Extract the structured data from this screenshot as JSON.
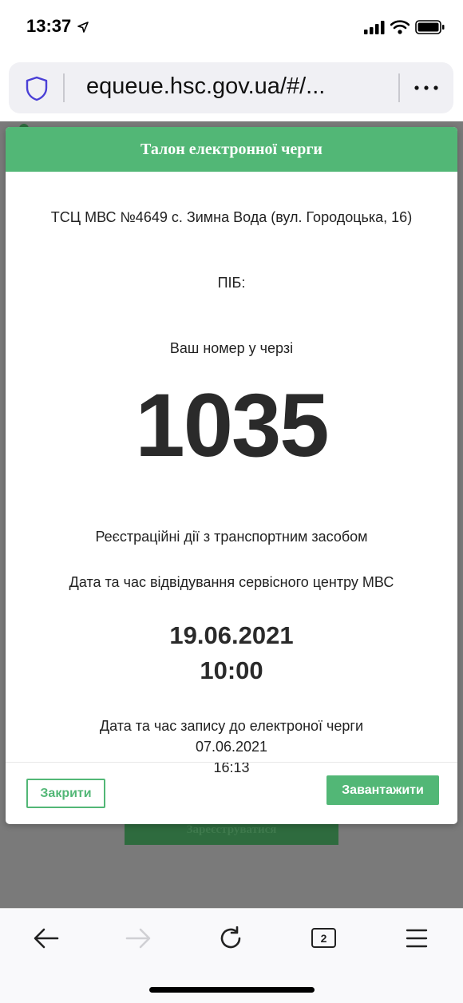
{
  "status_bar": {
    "time": "13:37"
  },
  "browser": {
    "url": "equeue.hsc.gov.ua/#/...",
    "tab_count": "2"
  },
  "background_page": {
    "register_label": "Зареєструватися"
  },
  "ticket": {
    "title": "Талон електронної черги",
    "service_center": "ТСЦ МВС №4649 с. Зимна Вода (вул. Городоцька, 16)",
    "pib_label": "ПІБ:",
    "queue_number_label": "Ваш номер у черзі",
    "queue_number": "1035",
    "service_name": "Реєстраційні дії з транспортним засобом",
    "visit_label": "Дата та час відвідування сервісного центру МВС",
    "visit_date": "19.06.2021",
    "visit_time": "10:00",
    "registration_label": "Дата та час запису до електроної черги",
    "registration_date": "07.06.2021",
    "registration_time": "16:13"
  },
  "buttons": {
    "close": "Закрити",
    "download": "Завантажити"
  },
  "colors": {
    "accent_green": "#52b776",
    "dim_overlay": "#7a7a7a",
    "browser_shield": "#4a3fd6"
  }
}
